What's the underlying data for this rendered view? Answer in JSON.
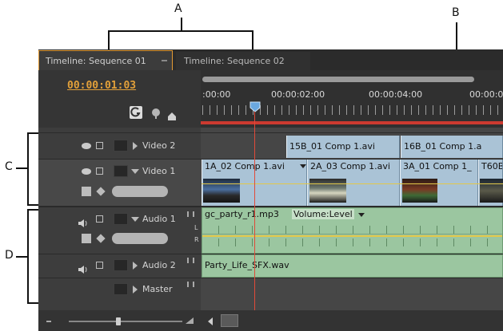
{
  "callouts": {
    "a": "A",
    "b": "B",
    "c": "C",
    "d": "D"
  },
  "tabs": [
    {
      "label": "Timeline: Sequence 01",
      "active": true
    },
    {
      "label": "Timeline: Sequence 02",
      "active": false
    }
  ],
  "timecode": "00:00:01:03",
  "ruler": {
    "labels": [
      ":00:00",
      "00:00:02:00",
      "00:00:04:00",
      "00:00:0"
    ]
  },
  "tracks": {
    "video2": {
      "label": "Video 2"
    },
    "video1": {
      "label": "Video 1"
    },
    "audio1": {
      "label": "Audio 1"
    },
    "audio2": {
      "label": "Audio 2"
    },
    "master": {
      "label": "Master"
    }
  },
  "clips": {
    "video2": [
      "15B_01 Comp 1.avi",
      "16B_01 Comp 1.a"
    ],
    "video1": [
      "1A_02 Comp 1.avi",
      "2A_03 Comp 1.avi",
      "3A_01 Comp 1_",
      "T60B"
    ],
    "audio1": {
      "name": "gc_party_r1.mp3",
      "effect": "Volume:Level"
    },
    "audio2": {
      "name": "Party_Life_SFX.wav"
    }
  },
  "audio_channels": {
    "left": "L",
    "right": "R"
  },
  "colors": {
    "panel_bg": "#3a3a3a",
    "timecode": "#e2a03a",
    "active_tab_border": "#e29a33",
    "video_clip": "#aac3d6",
    "audio_clip": "#9bc6a0",
    "playhead": "#e04a3a",
    "work_area_bar": "#cc3a30"
  },
  "icons": [
    "snap-icon",
    "marker-icon",
    "keyframe-icon",
    "eye-icon",
    "film-icon",
    "speaker-icon",
    "zoom-slider-icon",
    "scroll-left-icon"
  ]
}
